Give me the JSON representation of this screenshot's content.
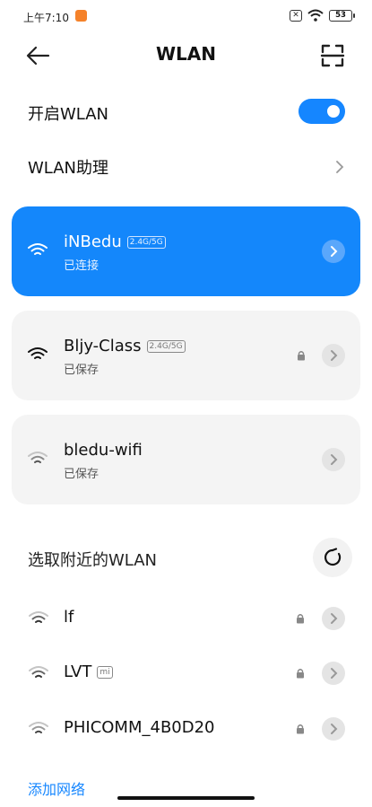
{
  "status_bar": {
    "time": "上午7:10",
    "battery": "53",
    "sim_x": "✕"
  },
  "nav": {
    "title": "WLAN"
  },
  "settings": {
    "wlan_on_label": "开启WLAN",
    "wlan_on": true,
    "assistant_label": "WLAN助理"
  },
  "saved_networks": [
    {
      "ssid": "iNBedu",
      "band": "2.4G/5G",
      "status": "已连接",
      "locked": false,
      "active": true
    },
    {
      "ssid": "Bljy-Class",
      "band": "2.4G/5G",
      "status": "已保存",
      "locked": true,
      "active": false
    },
    {
      "ssid": "bledu-wifi",
      "band": "",
      "status": "已保存",
      "locked": false,
      "active": false
    }
  ],
  "nearby": {
    "title": "选取附近的WLAN",
    "networks": [
      {
        "ssid": "lf",
        "badge": "",
        "locked": true
      },
      {
        "ssid": "LVT",
        "badge": "mi",
        "locked": true
      },
      {
        "ssid": "PHICOMM_4B0D20",
        "badge": "",
        "locked": true
      }
    ]
  },
  "add_network_label": "添加网络",
  "colors": {
    "accent": "#1586ff",
    "active_card": "#1487fb",
    "card_bg": "#f4f4f4"
  }
}
